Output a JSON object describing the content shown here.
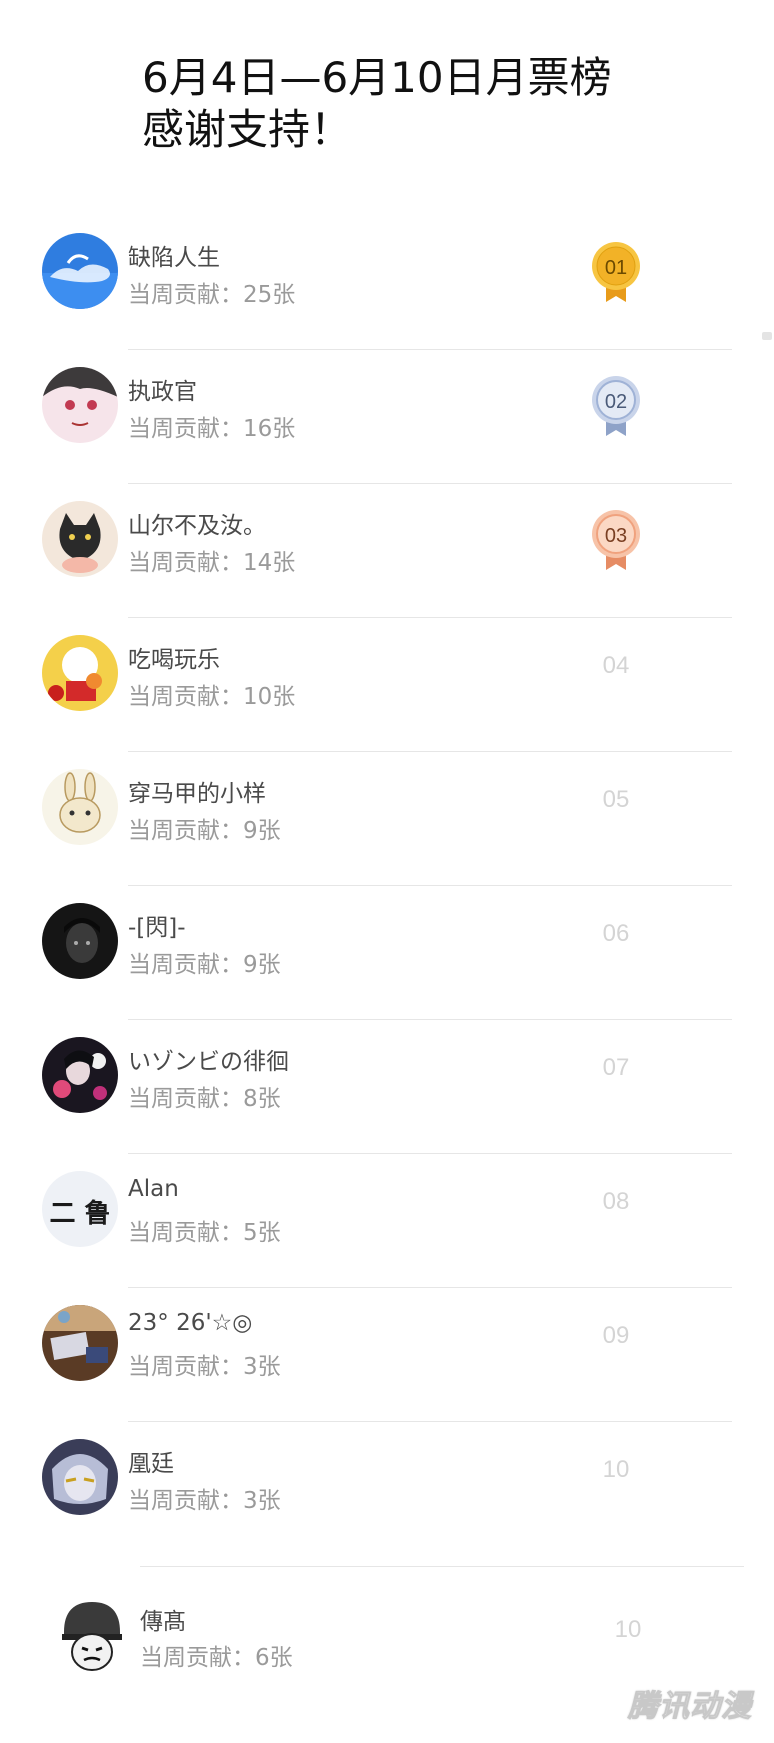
{
  "title": {
    "line1": "6月4日—6月10日月票榜",
    "line2": "感谢支持！"
  },
  "sub_prefix": "当周贡献：",
  "rows": [
    {
      "name": "缺陷人生",
      "sub": "当周贡献：25张",
      "rank": "01",
      "medal": "gold",
      "avatar_icon": "sky-avatar"
    },
    {
      "name": "执政官",
      "sub": "当周贡献：16张",
      "rank": "02",
      "medal": "silver",
      "avatar_icon": "anime-girl-avatar"
    },
    {
      "name": "山尔不及汝。",
      "sub": "当周贡献：14张",
      "rank": "03",
      "medal": "bronze",
      "avatar_icon": "cat-avatar"
    },
    {
      "name": "吃喝玩乐",
      "sub": "当周贡献：10张",
      "rank": "04",
      "medal": "",
      "avatar_icon": "lucky-cat-avatar"
    },
    {
      "name": "穿马甲的小样",
      "sub": "当周贡献：9张",
      "rank": "05",
      "medal": "",
      "avatar_icon": "bunny-avatar"
    },
    {
      "name": "-[閃]-",
      "sub": "当周贡献：9张",
      "rank": "06",
      "medal": "",
      "avatar_icon": "dark-portrait-avatar"
    },
    {
      "name": "いゾンビの徘徊",
      "sub": "当周贡献：8张",
      "rank": "07",
      "medal": "",
      "avatar_icon": "flowers-avatar"
    },
    {
      "name": "Alan",
      "sub": "当周贡献：5张",
      "rank": "08",
      "medal": "",
      "avatar_icon": "text-avatar"
    },
    {
      "name": "23°  26'☆◎",
      "sub": "当周贡献：3张",
      "rank": "09",
      "medal": "",
      "avatar_icon": "table-avatar"
    },
    {
      "name": "凰廷",
      "sub": "当周贡献：3张",
      "rank": "10",
      "medal": "",
      "avatar_icon": "anime-boy-avatar"
    }
  ],
  "last_row": {
    "name": "傳髙",
    "sub": "当周贡献：6张",
    "rank": "10",
    "avatar_icon": "helmet-meme-avatar"
  },
  "avatar_text": "二 鲁",
  "watermark": "腾讯动漫",
  "colors": {
    "gold": "#f2b227",
    "silver": "#9fb2d6",
    "bronze": "#f0a27e"
  }
}
